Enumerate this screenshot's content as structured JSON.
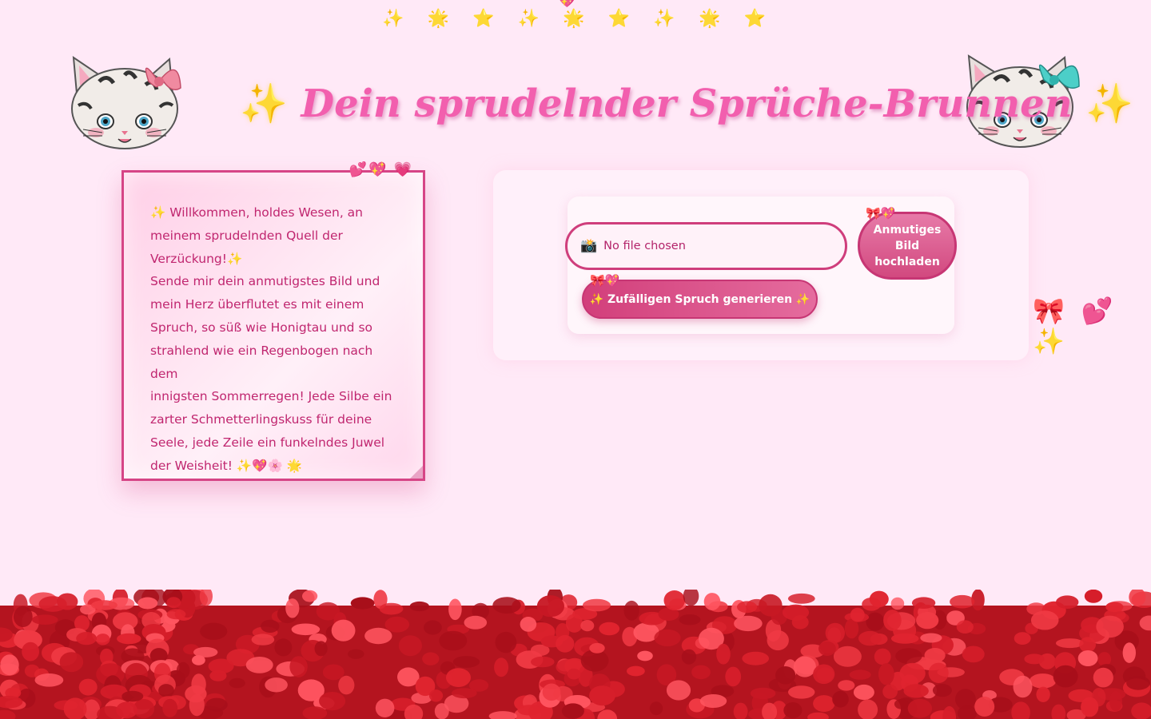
{
  "header": {
    "star_row": [
      "✨",
      "🌟",
      "⭐",
      "✨",
      "🌟",
      "⭐",
      "✨",
      "🌟",
      "⭐"
    ],
    "top_heart": "💖",
    "title_spark_left": "✨",
    "title": "Dein sprudelnder Sprüche-Brunnen",
    "title_spark_right": "✨"
  },
  "welcome_card": {
    "hearts": "💕💖 💗",
    "lines": [
      "✨ Willkommen, holdes Wesen, an",
      "meinem sprudelnden Quell der",
      "Verzückung!✨",
      "Sende mir dein anmutigstes Bild und",
      "mein Herz überflutet es mit einem",
      "Spruch, so süß wie Honigtau und so",
      "strahlend wie ein Regenbogen nach dem",
      "innigsten Sommerregen! Jede Silbe ein",
      "zarter Schmetterlingskuss für deine",
      "Seele, jede Zeile ein funkelndes Juwel",
      "der Weisheit! ✨💖🌸 🌟"
    ]
  },
  "upload": {
    "file_icon": "📸",
    "file_status": "No file chosen",
    "upload_label": "Anmutiges Bild hochladen",
    "upload_bow": "🎀💖",
    "generate_label": "✨ Zufälligen Spruch generieren ✨",
    "generate_bow": "🎀💖"
  },
  "side_deco": "🎀 💕 ✨",
  "colors": {
    "background": "#ffe9f7",
    "title": "#f25fae",
    "accent": "#d23f7b",
    "text": "#c0266f"
  }
}
